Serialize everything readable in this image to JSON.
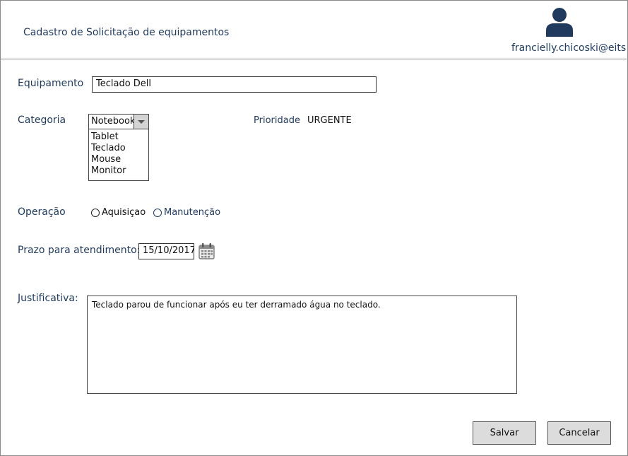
{
  "header": {
    "title": "Cadastro de Solicitação de equipamentos",
    "user_name": "francielly.chicoski@eits...."
  },
  "form": {
    "equipamento": {
      "label": "Equipamento",
      "value": "Teclado Dell"
    },
    "categoria": {
      "label": "Categoria",
      "selected": "Notebook",
      "options": [
        "Tablet",
        "Teclado",
        "Mouse",
        "Monitor"
      ]
    },
    "prioridade": {
      "label": "Prioridade",
      "value": "URGENTE"
    },
    "operacao": {
      "label": "Operação",
      "options": [
        "Aquisiçao",
        "Manutenção"
      ]
    },
    "prazo": {
      "label": "Prazo para atendimento:",
      "value": "15/10/2017"
    },
    "justificativa": {
      "label": "Justificativa:",
      "value": "Teclado parou de funcionar após eu ter derramado água no teclado."
    }
  },
  "actions": {
    "save_label": "Salvar",
    "cancel_label": "Cancelar"
  },
  "colors": {
    "text_primary": "#1f3a5c",
    "button_bg": "#dcdcdc",
    "border": "#8a8a8a"
  },
  "icons": {
    "avatar": "user-avatar-icon",
    "calendar": "calendar-icon",
    "dropdown": "chevron-down-icon"
  }
}
